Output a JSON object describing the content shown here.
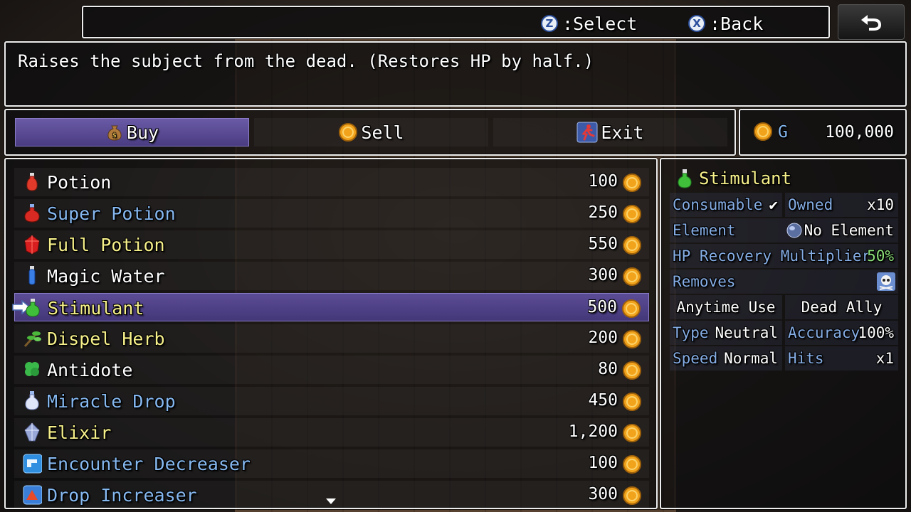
{
  "help": {
    "select_key": "Z",
    "select_label": ":Select",
    "back_key": "X",
    "back_label": ":Back"
  },
  "description": "Raises the subject from the dead. (Restores HP by half.)",
  "commands": [
    {
      "label": "Buy",
      "icon": "money-bag-icon",
      "active": true
    },
    {
      "label": "Sell",
      "icon": "coin-icon",
      "active": false
    },
    {
      "label": "Exit",
      "icon": "running-man-icon",
      "active": false
    }
  ],
  "gold": {
    "unit": "G",
    "amount": "100,000"
  },
  "items": [
    {
      "name": "Potion",
      "price": "100",
      "color": "#ffffff",
      "icon": "red-potion-icon"
    },
    {
      "name": "Super Potion",
      "price": "250",
      "color": "#86b8f0",
      "icon": "red-flask-icon"
    },
    {
      "name": "Full Potion",
      "price": "550",
      "color": "#f6f08a",
      "icon": "red-gem-potion-icon"
    },
    {
      "name": "Magic Water",
      "price": "300",
      "color": "#ffffff",
      "icon": "blue-vial-icon"
    },
    {
      "name": "Stimulant",
      "price": "500",
      "color": "#f6f08a",
      "icon": "green-flask-icon",
      "selected": true
    },
    {
      "name": "Dispel Herb",
      "price": "200",
      "color": "#f6f08a",
      "icon": "herb-icon"
    },
    {
      "name": "Antidote",
      "price": "80",
      "color": "#ffffff",
      "icon": "clover-icon"
    },
    {
      "name": "Miracle Drop",
      "price": "450",
      "color": "#86b8f0",
      "icon": "white-drop-icon"
    },
    {
      "name": "Elixir",
      "price": "1,200",
      "color": "#f6f08a",
      "icon": "crystal-icon"
    },
    {
      "name": "Encounter Decreaser",
      "price": "100",
      "color": "#86b8f0",
      "icon": "blue-tile-icon"
    },
    {
      "name": "Drop Increaser",
      "price": "300",
      "color": "#86b8f0",
      "icon": "red-tile-icon"
    }
  ],
  "info": {
    "title": "Stimulant",
    "consumable_label": "Consumable",
    "consumable_mark": "✔",
    "owned_label": "Owned",
    "owned_value": "x10",
    "element_label": "Element",
    "element_value": "No Element",
    "hp_label": "HP Recovery Multiplier",
    "hp_value": "50%",
    "removes_label": "Removes",
    "anytime": "Anytime Use",
    "target": "Dead Ally",
    "type_label": "Type",
    "type_value": "Neutral",
    "accuracy_label": "Accuracy",
    "accuracy_value": "100%",
    "speed_label": "Speed",
    "speed_value": "Normal",
    "hits_label": "Hits",
    "hits_value": "x1"
  }
}
